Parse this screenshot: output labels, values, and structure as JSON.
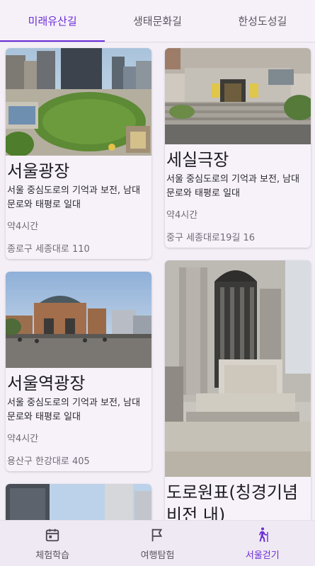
{
  "tabs": [
    {
      "label": "미래유산길",
      "active": true
    },
    {
      "label": "생태문화길",
      "active": false
    },
    {
      "label": "한성도성길",
      "active": false
    }
  ],
  "cards": {
    "left": [
      {
        "title": "서울광장",
        "desc": "서울 중심도로의 기억과 보전, 남대문로와 태평로 일대",
        "time": "약4시간",
        "addr": "종로구 세종대로 110",
        "image": "seoul-plaza-photo"
      },
      {
        "title": "서울역광장",
        "desc": "서울 중심도로의 기억과 보전, 남대문로와 태평로 일대",
        "time": "약4시간",
        "addr": "용산구 한강대로 405",
        "image": "seoul-station-plaza-photo"
      },
      {
        "title": "",
        "image": "building-photo"
      }
    ],
    "right": [
      {
        "title": "세실극장",
        "desc": "서울 중심도로의 기억과 보전, 남대문로와 태평로 일대",
        "time": "약4시간",
        "addr": "중구 세종대로19길 16",
        "image": "cecil-theatre-photo"
      },
      {
        "title": "도로원표(칭경기념비전 내)",
        "image": "road-origin-marker-photo"
      }
    ]
  },
  "bottom_nav": [
    {
      "label": "체험학습",
      "icon": "calendar-icon",
      "active": false
    },
    {
      "label": "여행탐험",
      "icon": "flag-icon",
      "active": false
    },
    {
      "label": "서울걷기",
      "icon": "hiking-icon",
      "active": true
    }
  ],
  "colors": {
    "accent": "#6a2bd8",
    "background": "#f4eff7"
  }
}
